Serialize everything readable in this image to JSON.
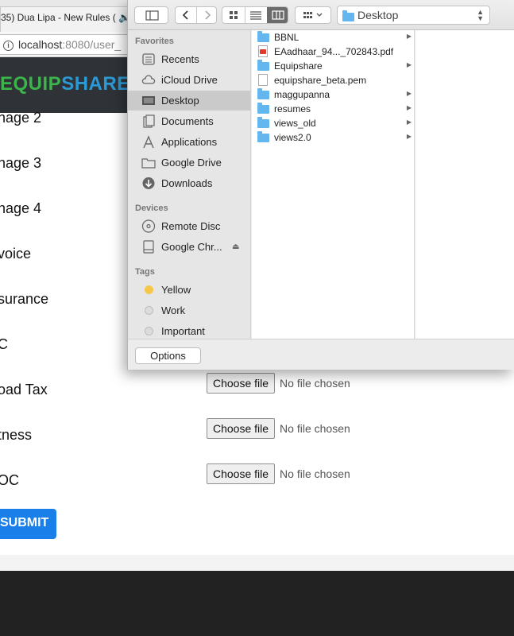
{
  "browser": {
    "tab_title": "35) Dua Lipa - New Rules (",
    "tab_audio_glyph": "🔈",
    "url_host": "localhost",
    "url_path": ":8080/user_"
  },
  "site": {
    "logo_part1": "EQUIPSHARE",
    "logo_part2": "",
    "form_labels": [
      "nage 2",
      "nage 3",
      "nage 4",
      "voice",
      "surance",
      "C",
      "oad Tax",
      "tness",
      "OC"
    ],
    "file_inputs": [
      {
        "button": "Choose file",
        "status": "No file chosen"
      },
      {
        "button": "Choose file",
        "status": "No file chosen"
      },
      {
        "button": "Choose file",
        "status": "No file chosen"
      }
    ],
    "submit_label": "SUBMIT"
  },
  "dialog": {
    "location": "Desktop",
    "sidebar": {
      "favorites_heading": "Favorites",
      "favorites": [
        {
          "label": "Recents",
          "icon": "recents-icon"
        },
        {
          "label": "iCloud Drive",
          "icon": "cloud-icon"
        },
        {
          "label": "Desktop",
          "icon": "desktop-icon",
          "selected": true
        },
        {
          "label": "Documents",
          "icon": "documents-icon"
        },
        {
          "label": "Applications",
          "icon": "applications-icon"
        },
        {
          "label": "Google Drive",
          "icon": "folder-icon"
        },
        {
          "label": "Downloads",
          "icon": "downloads-icon"
        }
      ],
      "devices_heading": "Devices",
      "devices": [
        {
          "label": "Remote Disc",
          "icon": "disc-icon"
        },
        {
          "label": "Google Chr...",
          "icon": "drive-icon",
          "eject": "⏏"
        }
      ],
      "tags_heading": "Tags",
      "tags": [
        {
          "label": "Yellow",
          "color": "#f5c84b"
        },
        {
          "label": "Work",
          "color": "#dcdcdc"
        },
        {
          "label": "Important",
          "color": "#dcdcdc"
        }
      ]
    },
    "files": [
      {
        "name": "BBNL",
        "type": "folder"
      },
      {
        "name": "EAadhaar_94..._702843.pdf",
        "type": "pdf"
      },
      {
        "name": "Equipshare",
        "type": "folder"
      },
      {
        "name": "equipshare_beta.pem",
        "type": "doc"
      },
      {
        "name": "maggupanna",
        "type": "folder"
      },
      {
        "name": "resumes",
        "type": "folder"
      },
      {
        "name": "views_old",
        "type": "folder"
      },
      {
        "name": "views2.0",
        "type": "folder"
      }
    ],
    "options_label": "Options"
  }
}
